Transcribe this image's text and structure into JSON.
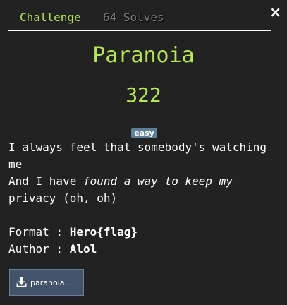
{
  "tabs": {
    "challenge": "Challenge",
    "solves": "64 Solves"
  },
  "close_icon": "×",
  "challenge": {
    "name": "Paranoia",
    "points": "322",
    "difficulty": "easy",
    "description": {
      "line1": "I always feel that somebody's watching",
      "line2": "me",
      "line3_prefix": "And I have ",
      "line3_italic": "found a way to keep my",
      "line4": "privacy (oh, oh)",
      "format_label": "Format : ",
      "format_value": "Hero{flag}",
      "author_label": "Author : ",
      "author_value": "Alol"
    },
    "file": {
      "label": "paranoia...",
      "icon": "download-icon"
    }
  },
  "colors": {
    "background": "#222222",
    "accent": "#b5e853",
    "muted": "#7a7a7a",
    "badge": "#5f7f99",
    "file_button": "#435369"
  }
}
